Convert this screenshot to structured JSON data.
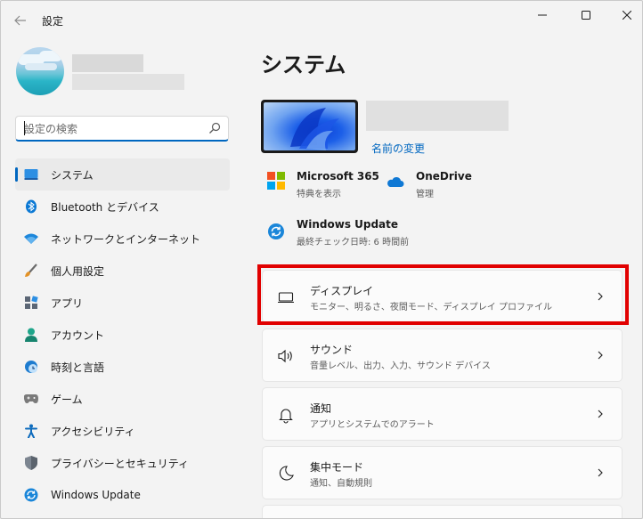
{
  "window": {
    "title": "設定"
  },
  "search": {
    "placeholder": "設定の検索"
  },
  "sidebar": {
    "items": [
      {
        "label": "システム",
        "icon": "system-icon"
      },
      {
        "label": "Bluetooth とデバイス",
        "icon": "bluetooth-icon"
      },
      {
        "label": "ネットワークとインターネット",
        "icon": "wifi-icon"
      },
      {
        "label": "個人用設定",
        "icon": "brush-icon"
      },
      {
        "label": "アプリ",
        "icon": "apps-icon"
      },
      {
        "label": "アカウント",
        "icon": "account-icon"
      },
      {
        "label": "時刻と言語",
        "icon": "clock-globe-icon"
      },
      {
        "label": "ゲーム",
        "icon": "gamepad-icon"
      },
      {
        "label": "アクセシビリティ",
        "icon": "accessibility-icon"
      },
      {
        "label": "プライバシーとセキュリティ",
        "icon": "shield-icon"
      },
      {
        "label": "Windows Update",
        "icon": "update-icon"
      }
    ]
  },
  "main": {
    "title": "システム",
    "rename_label": "名前の変更",
    "quick": [
      {
        "title": "Microsoft 365",
        "sub": "特典を表示",
        "icon": "microsoft365-icon"
      },
      {
        "title": "OneDrive",
        "sub": "管理",
        "icon": "onedrive-icon"
      },
      {
        "title": "Windows Update",
        "sub": "最終チェック日時: 6 時間前",
        "icon": "update-icon"
      }
    ],
    "cards": [
      {
        "title": "ディスプレイ",
        "sub": "モニター、明るさ、夜間モード、ディスプレイ プロファイル",
        "icon": "display-icon"
      },
      {
        "title": "サウンド",
        "sub": "音量レベル、出力、入力、サウンド デバイス",
        "icon": "speaker-icon"
      },
      {
        "title": "通知",
        "sub": "アプリとシステムでのアラート",
        "icon": "bell-icon"
      },
      {
        "title": "集中モード",
        "sub": "通知、自動規則",
        "icon": "moon-icon"
      }
    ]
  },
  "colors": {
    "accent": "#0067c0",
    "highlight": "#e10000"
  }
}
